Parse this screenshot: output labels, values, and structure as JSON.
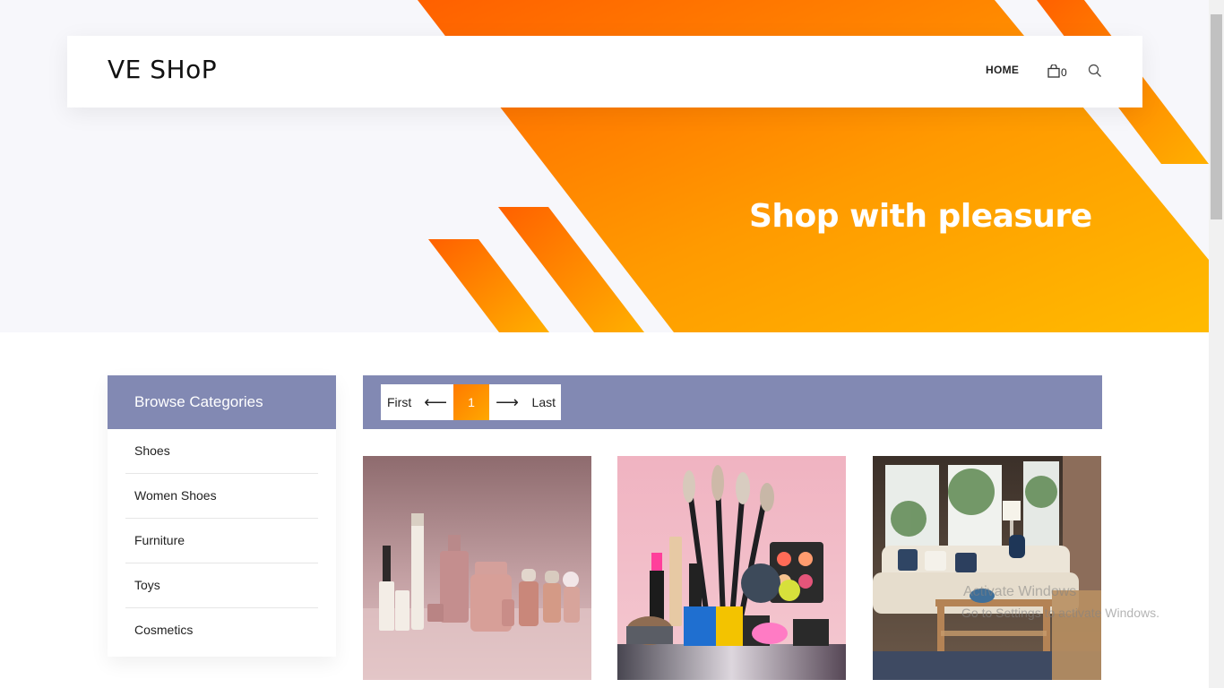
{
  "header": {
    "brand": "VE SHoP",
    "nav_home": "HOME",
    "cart_count": "0"
  },
  "hero": {
    "title": "Shop with pleasure"
  },
  "sidebar": {
    "title": "Browse Categories",
    "categories": [
      "Shoes",
      "Women Shoes",
      "Furniture",
      "Toys",
      "Cosmetics"
    ]
  },
  "pagination": {
    "first": "First",
    "prev": "⟵",
    "current": "1",
    "next": "⟶",
    "last": "Last"
  },
  "products": [
    {
      "icon": "cosmetics-bottles-image"
    },
    {
      "icon": "makeup-brushes-image"
    },
    {
      "icon": "living-room-image"
    }
  ],
  "watermark": {
    "line1": "Activate Windows",
    "line2": "Go to Settings to activate Windows."
  },
  "colors": {
    "accent_orange": "#ff6a00",
    "accent_yellow": "#ffb300",
    "sidebar_header": "#8289b3",
    "hero_bg": "#f7f7fb"
  }
}
